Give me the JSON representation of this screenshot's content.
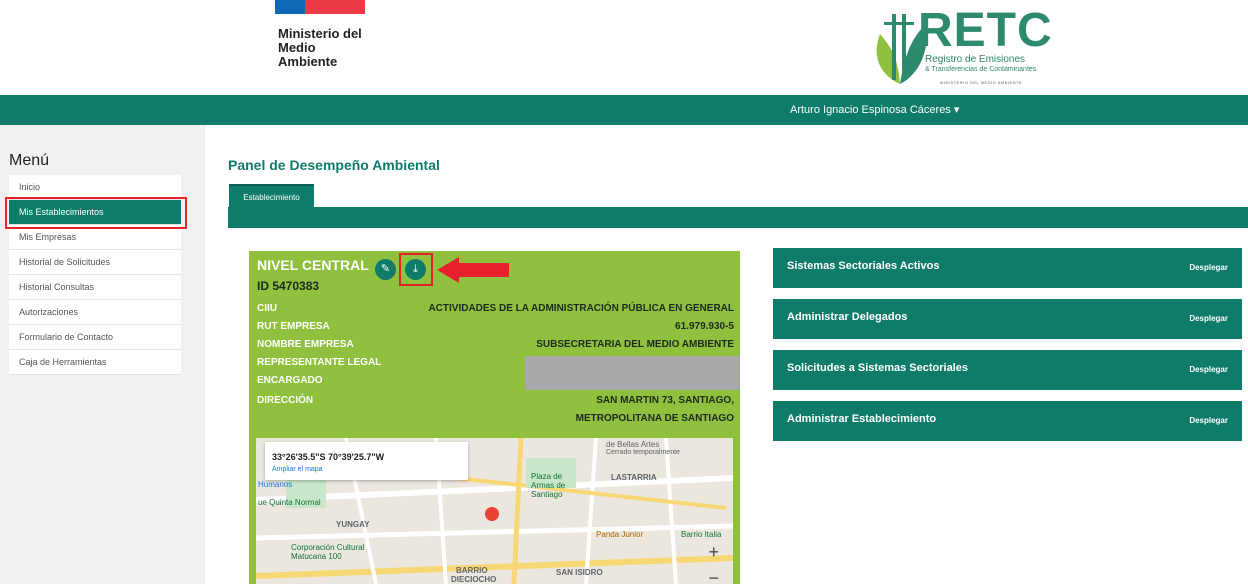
{
  "header": {
    "ministry_line1": "Ministerio del",
    "ministry_line2": "Medio",
    "ministry_line3": "Ambiente",
    "retc_word": "RETC",
    "retc_sub1": "Registro de Emisiones",
    "retc_sub2": "& Transferencias de Contaminantes",
    "retc_sub3": "MINISTERIO DEL MEDIO AMBIENTE"
  },
  "topbar": {
    "user": "Arturo Ignacio Espinosa Cáceres ▾"
  },
  "sidebar": {
    "title": "Menú",
    "items": [
      {
        "label": "Inicio"
      },
      {
        "label": "Mis Establecimientos"
      },
      {
        "label": "Mis Empresas"
      },
      {
        "label": "Historial de Solicitudes"
      },
      {
        "label": "Historial Consultas"
      },
      {
        "label": "Autorizaciones"
      },
      {
        "label": "Formulario de Contacto"
      },
      {
        "label": "Caja de Herramientas"
      }
    ]
  },
  "main": {
    "title": "Panel de Desempeño Ambiental",
    "tab": "Establecimiento"
  },
  "card": {
    "name": "NIVEL CENTRAL",
    "id": "ID 5470383",
    "rows": [
      {
        "label": "CIIU",
        "value": "ACTIVIDADES DE LA ADMINISTRACIÓN PÚBLICA EN GENERAL"
      },
      {
        "label": "RUT EMPRESA",
        "value": "61.979.930-5"
      },
      {
        "label": "NOMBRE EMPRESA",
        "value": "SUBSECRETARIA DEL MEDIO AMBIENTE"
      },
      {
        "label": "REPRESENTANTE LEGAL",
        "value": ""
      },
      {
        "label": "ENCARGADO",
        "value": ""
      },
      {
        "label": "DIRECCIÓN",
        "value": "SAN MARTIN 73, SANTIAGO,"
      },
      {
        "label": "",
        "value": "METROPOLITANA DE SANTIAGO"
      }
    ]
  },
  "map": {
    "coords": "33°26'35.5\"S 70°39'25.7\"W",
    "ampliar": "Ampliar el mapa",
    "labels": {
      "bellas_artes": "de Bellas Artes",
      "cerrado": "Cerrado temporalmente",
      "humanos": "Humanos",
      "quinta": "ue Quinta Normal",
      "yungay": "YUNGAY",
      "plaza1": "Plaza de",
      "plaza2": "Armas de",
      "plaza3": "Santiago",
      "lastarria": "LASTARRIA",
      "corp1": "Corporación Cultural",
      "corp2": "Matucana 100",
      "panda": "Panda Junior",
      "barrio_italia": "Barrio Italia",
      "barrio": "BARRIO",
      "dieciocho": "DIECIOCHO",
      "san_isidro": "SAN ISIDRO"
    },
    "zoom_in": "+",
    "zoom_out": "−"
  },
  "accordions": [
    {
      "title": "Sistemas Sectoriales Activos",
      "toggle": "Desplegar"
    },
    {
      "title": "Administrar Delegados",
      "toggle": "Desplegar"
    },
    {
      "title": "Solicitudes a Sistemas Sectoriales",
      "toggle": "Desplegar"
    },
    {
      "title": "Administrar Establecimiento",
      "toggle": "Desplegar"
    }
  ],
  "icons": {
    "edit": "pencil-icon",
    "download": "download-icon",
    "arrow": "red-arrow-icon",
    "marker": "map-marker-icon"
  },
  "colors": {
    "brand_green": "#0f7c6a",
    "card_green": "#8fc13f",
    "highlight_red": "#e8202e"
  }
}
